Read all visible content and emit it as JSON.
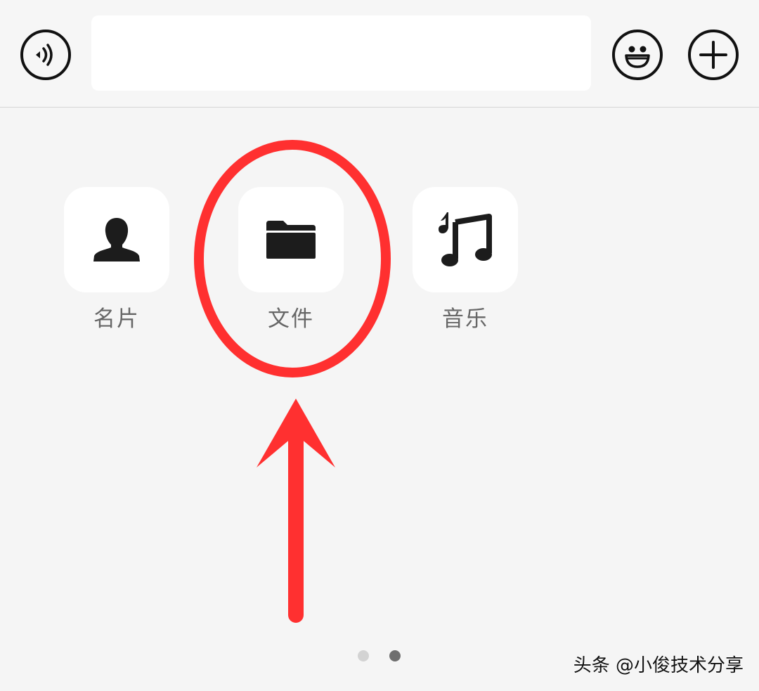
{
  "input_bar": {
    "voice_icon": "voice-wave-icon",
    "text_value": "",
    "emoji_icon": "smiley-face-icon",
    "plus_icon": "plus-icon"
  },
  "panel": {
    "items": [
      {
        "label": "名片",
        "icon": "person-icon"
      },
      {
        "label": "文件",
        "icon": "folder-icon"
      },
      {
        "label": "音乐",
        "icon": "music-note-icon"
      }
    ]
  },
  "pager": {
    "pages": 2,
    "current_page": 2
  },
  "annotation": {
    "color": "#ff3030"
  },
  "watermark": {
    "text": "头条 @小俊技术分享"
  }
}
